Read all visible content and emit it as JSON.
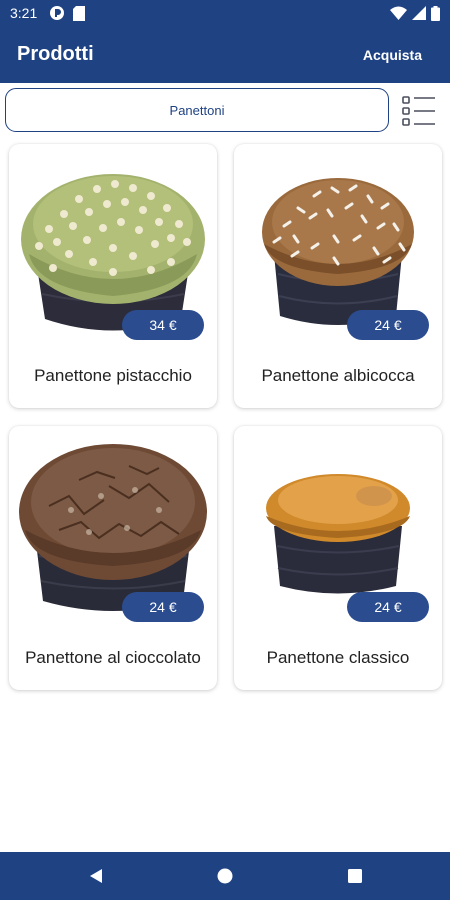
{
  "status_bar": {
    "time": "3:21"
  },
  "app_bar": {
    "title": "Prodotti",
    "action_label": "Acquista"
  },
  "filter": {
    "category": "Panettoni"
  },
  "products": [
    {
      "name": "Panettone pistacchio",
      "price": "34 €",
      "image_icon": "panettone-pistachio-image"
    },
    {
      "name": "Panettone albicocca",
      "price": "24 €",
      "image_icon": "panettone-apricot-image"
    },
    {
      "name": "Panettone al cioccolato",
      "price": "24 €",
      "image_icon": "panettone-chocolate-image"
    },
    {
      "name": "Panettone classico",
      "price": "24 €",
      "image_icon": "panettone-classic-image"
    }
  ],
  "colors": {
    "primary": "#1f4283",
    "badge": "#2b4d8f",
    "pistachio_glaze": "#9cae6a",
    "paper_case": "#2c2c3a"
  }
}
